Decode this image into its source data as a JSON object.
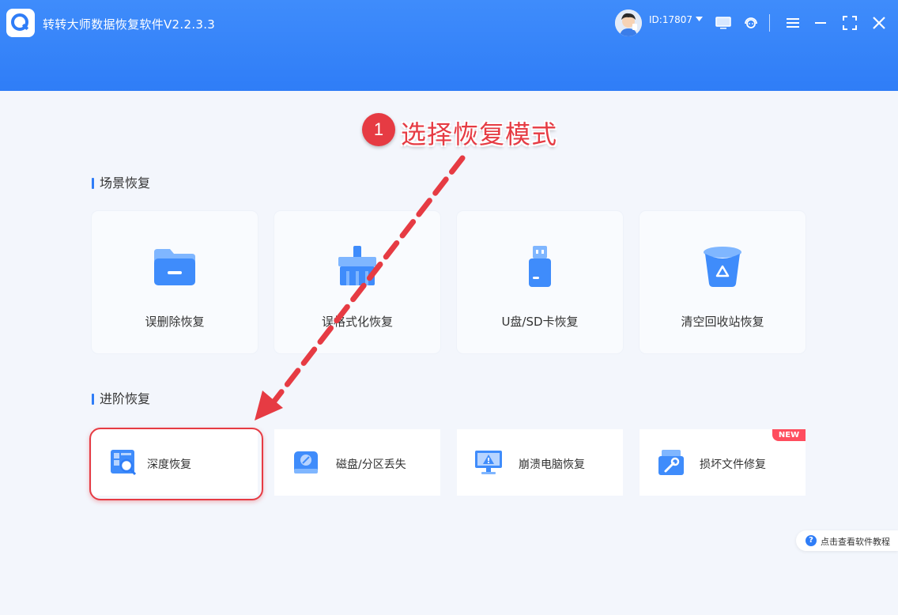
{
  "app": {
    "title": "转转大师数据恢复软件V2.2.3.3"
  },
  "user": {
    "id_label": "ID:17807"
  },
  "annotation": {
    "step_number": "1",
    "step_text": "选择恢复模式"
  },
  "sections": {
    "scene": {
      "title": "场景恢复",
      "cards": [
        {
          "label": "误删除恢复",
          "icon": "folder-icon"
        },
        {
          "label": "误格式化恢复",
          "icon": "broom-icon"
        },
        {
          "label": "U盘/SD卡恢复",
          "icon": "usb-drive-icon"
        },
        {
          "label": "清空回收站恢复",
          "icon": "recycle-bin-icon"
        }
      ]
    },
    "advanced": {
      "title": "进阶恢复",
      "cards": [
        {
          "label": "深度恢复",
          "icon": "deep-scan-icon"
        },
        {
          "label": "磁盘/分区丢失",
          "icon": "disk-icon"
        },
        {
          "label": "崩溃电脑恢复",
          "icon": "crashed-monitor-icon"
        },
        {
          "label": "损坏文件修复",
          "icon": "file-repair-icon"
        }
      ],
      "badge": "NEW"
    }
  },
  "help": {
    "label": "点击查看软件教程"
  },
  "colors": {
    "primary": "#2f7df7",
    "annotation_red": "#e63b43",
    "badge_red": "#ff4d5e"
  }
}
